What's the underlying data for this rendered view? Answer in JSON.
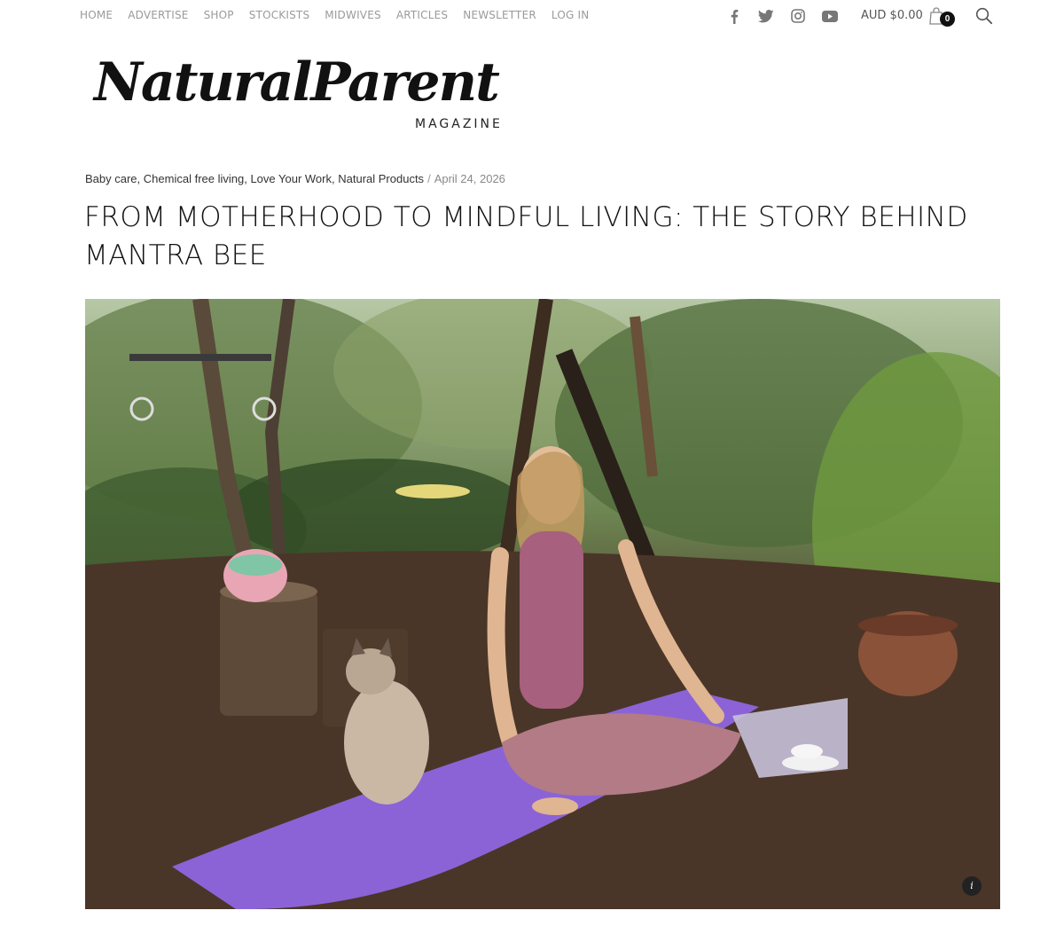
{
  "nav": {
    "items": [
      "HOME",
      "ADVERTISE",
      "SHOP",
      "STOCKISTS",
      "MIDWIVES",
      "ARTICLES",
      "NEWSLETTER",
      "LOG IN"
    ]
  },
  "social": [
    "facebook-icon",
    "twitter-icon",
    "instagram-icon",
    "youtube-icon"
  ],
  "cart": {
    "total": "AUD $0.00",
    "count": "0"
  },
  "logo": {
    "main": "NaturalParent",
    "sub": "MAGAZINE"
  },
  "post": {
    "categories": [
      "Baby care",
      "Chemical free living",
      "Love Your Work",
      "Natural Products"
    ],
    "date": "April 24, 2026",
    "title": "FROM MOTHERHOOD TO MINDFUL LIVING: THE STORY BEHIND MANTRA BEE"
  },
  "image": {
    "info_label": "i"
  },
  "colors": {
    "nav_text": "#9a9a9a",
    "accent_mat": "#8b63d6",
    "top_pink": "#b06a86"
  }
}
